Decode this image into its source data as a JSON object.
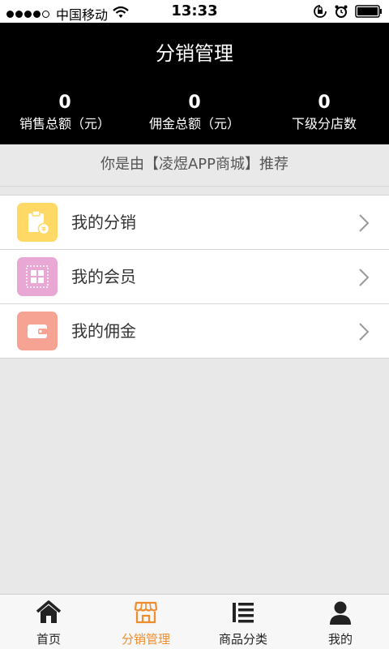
{
  "status_bar": {
    "carrier": "中国移动",
    "time": "13:33"
  },
  "header": {
    "title": "分销管理"
  },
  "stats": [
    {
      "value": "0",
      "label": "销售总额（元）"
    },
    {
      "value": "0",
      "label": "佣金总额（元）"
    },
    {
      "value": "0",
      "label": "下级分店数"
    }
  ],
  "referral": {
    "text": "你是由【凌煜APP商城】推荐"
  },
  "menu": [
    {
      "label": "我的分销",
      "icon": "clipboard-icon",
      "color": "#ffd966"
    },
    {
      "label": "我的会员",
      "icon": "grid-icon",
      "color": "#e9a8d4"
    },
    {
      "label": "我的佣金",
      "icon": "wallet-icon",
      "color": "#f7a394"
    }
  ],
  "tabbar": {
    "items": [
      {
        "label": "首页",
        "icon": "home-icon"
      },
      {
        "label": "分销管理",
        "icon": "store-icon",
        "active": true
      },
      {
        "label": "商品分类",
        "icon": "list-icon"
      },
      {
        "label": "我的",
        "icon": "user-icon"
      }
    ],
    "accent": "#f08c2e"
  }
}
